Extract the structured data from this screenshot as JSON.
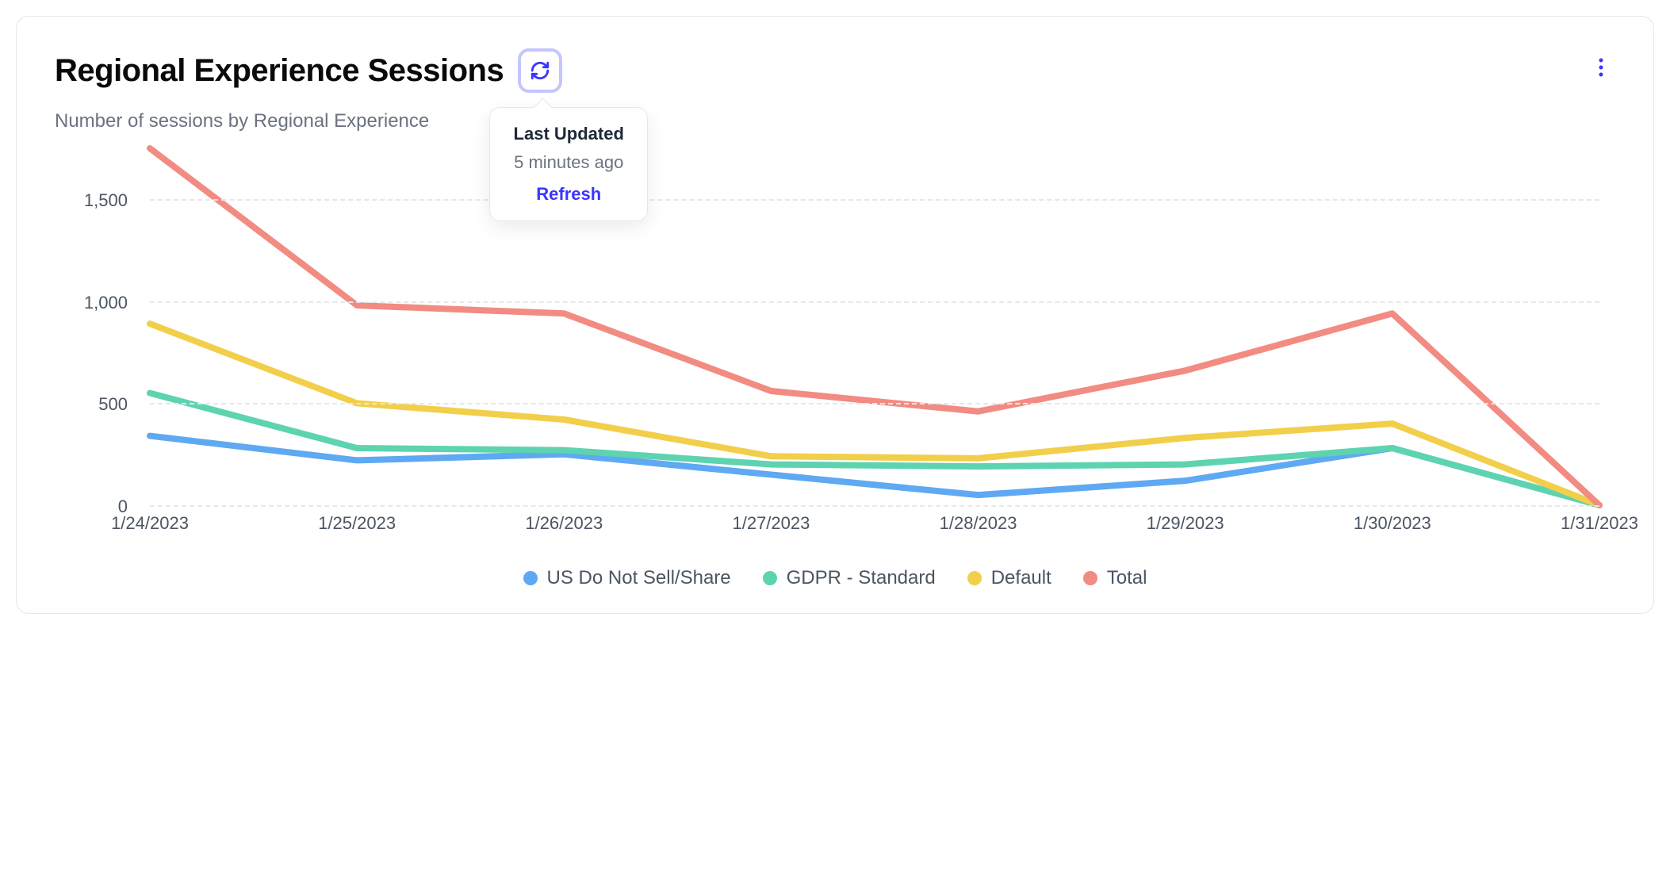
{
  "header": {
    "title": "Regional Experience Sessions",
    "subtitle": "Number of sessions by Regional Experience"
  },
  "popover": {
    "title": "Last Updated",
    "time": "5 minutes ago",
    "action": "Refresh"
  },
  "chart_data": {
    "type": "line",
    "categories": [
      "1/24/2023",
      "1/25/2023",
      "1/26/2023",
      "1/27/2023",
      "1/28/2023",
      "1/29/2023",
      "1/30/2023",
      "1/31/2023"
    ],
    "y_ticks": [
      0,
      500,
      1000,
      1500
    ],
    "y_tick_labels": [
      "0",
      "500",
      "1,000",
      "1,500"
    ],
    "ylim": [
      0,
      1750
    ],
    "series": [
      {
        "name": "US Do Not Sell/Share",
        "color": "#5ea9f2",
        "values": [
          340,
          220,
          250,
          150,
          50,
          120,
          280,
          0
        ]
      },
      {
        "name": "GDPR - Standard",
        "color": "#5ed3b0",
        "values": [
          550,
          280,
          270,
          200,
          190,
          200,
          280,
          0
        ]
      },
      {
        "name": "Default",
        "color": "#f2cf4a",
        "values": [
          890,
          500,
          420,
          240,
          230,
          330,
          400,
          0
        ]
      },
      {
        "name": "Total",
        "color": "#f28b82",
        "values": [
          1750,
          980,
          940,
          560,
          460,
          660,
          940,
          0
        ]
      }
    ],
    "xlabel": "",
    "ylabel": ""
  }
}
